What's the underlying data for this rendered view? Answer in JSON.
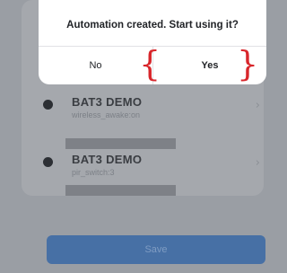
{
  "devices": [
    {
      "name": "BAT3 DEMO",
      "subtitle": "wireless_awake:on"
    },
    {
      "name": "BAT3 DEMO",
      "subtitle": "pir_switch:3"
    }
  ],
  "save_button": {
    "label": "Save"
  },
  "dialog": {
    "title": "Automation created. Start using it?",
    "no_label": "No",
    "yes_label": "Yes"
  },
  "annotation": {
    "left_brace": "{",
    "right_brace": "}",
    "color": "#d8262b"
  },
  "icons": {
    "row_arrow": "chevron-right-icon",
    "device": "device-dot-icon"
  },
  "colors": {
    "primary": "#4770a5",
    "overlay": "#9a9ea4"
  }
}
